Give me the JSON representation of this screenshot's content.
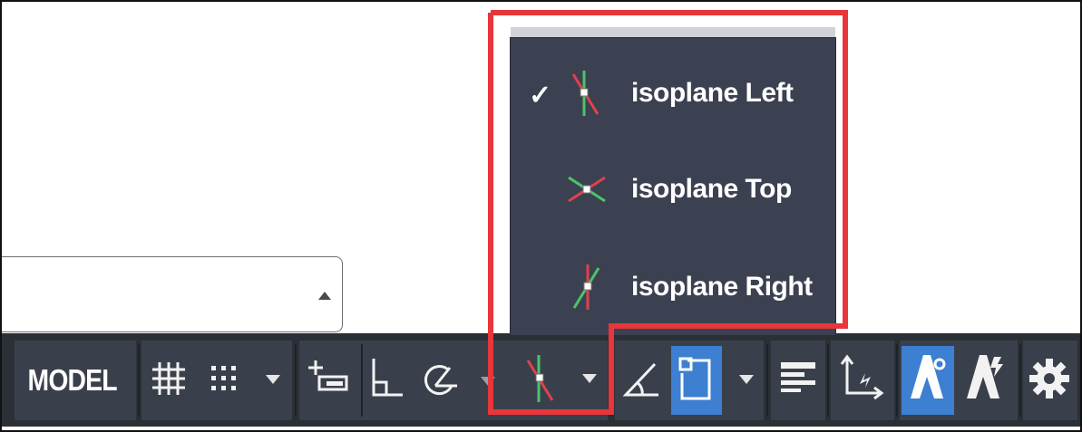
{
  "colors": {
    "statusbar_bg": "#2b2f36",
    "button_bg": "#3a404b",
    "menu_bg": "#3b4150",
    "active_blue": "#3d7fd0",
    "highlight_red": "#e8363b",
    "axis_green": "#4cc36a",
    "axis_red": "#e0414c"
  },
  "statusbar": {
    "model_label": "MODEL",
    "items": [
      {
        "name": "grid-icon"
      },
      {
        "name": "snap-mode-icon"
      },
      {
        "name": "snap-dropdown-icon"
      },
      {
        "name": "dynamic-input-icon"
      },
      {
        "name": "ortho-mode-icon"
      },
      {
        "name": "polar-tracking-icon"
      },
      {
        "name": "isodraft-icon"
      },
      {
        "name": "isodraft-dropdown-icon"
      },
      {
        "name": "object-snap-tracking-icon"
      },
      {
        "name": "object-snap-icon"
      },
      {
        "name": "osnap-dropdown-icon"
      },
      {
        "name": "lineweight-icon"
      },
      {
        "name": "ucs-icon"
      },
      {
        "name": "annotation-visibility-icon"
      },
      {
        "name": "auto-scale-icon"
      },
      {
        "name": "gear-icon"
      }
    ]
  },
  "isoplane_menu": {
    "items": [
      {
        "label": "isoplane Left",
        "checked": true,
        "icon": "isoplane-left-icon"
      },
      {
        "label": "isoplane Top",
        "checked": false,
        "icon": "isoplane-top-icon"
      },
      {
        "label": "isoplane Right",
        "checked": false,
        "icon": "isoplane-right-icon"
      }
    ],
    "check_glyph": "✓"
  }
}
